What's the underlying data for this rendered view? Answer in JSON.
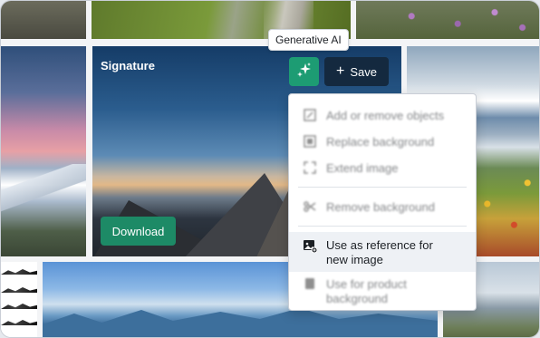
{
  "tooltip": {
    "text": "Generative AI"
  },
  "card": {
    "title": "Signature",
    "save_label": "Save",
    "save_icon": "plus-icon",
    "download_label": "Download",
    "gen_ai_icon": "sparkles-icon",
    "gen_ai_color": "#1d9c73",
    "save_color": "#14293f",
    "download_color": "#1d8a66"
  },
  "menu": {
    "items": [
      {
        "label": "Add or remove objects",
        "icon": "edit-objects-icon",
        "blurred": true
      },
      {
        "label": "Replace background",
        "icon": "replace-background-icon",
        "blurred": true
      },
      {
        "label": "Extend image",
        "icon": "extend-image-icon",
        "blurred": true
      },
      {
        "label": "Remove background",
        "icon": "scissors-icon",
        "blurred": true
      },
      {
        "label": "Use as reference for new image",
        "line1": "Use as reference for",
        "line2": "new image",
        "icon": "image-reference-icon",
        "blurred": false
      },
      {
        "label": "Use for product background",
        "line1": "Use for product",
        "line2": "background",
        "icon": "product-icon",
        "blurred": true
      }
    ]
  }
}
